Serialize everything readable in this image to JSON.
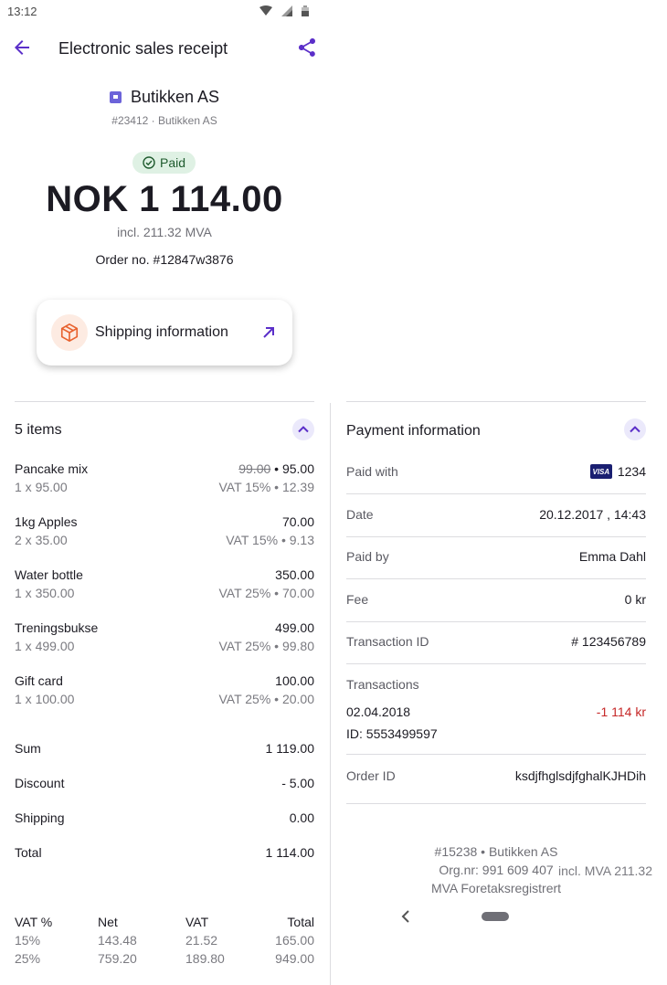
{
  "status_bar": {
    "time": "13:12"
  },
  "header": {
    "title": "Electronic sales receipt"
  },
  "merchant": {
    "name": "Butikken AS",
    "sub": "#23412 · Butikken AS"
  },
  "receipt": {
    "status": "Paid",
    "amount": "NOK 1 114.00",
    "incl_mva": "incl. 211.32 MVA",
    "order_no": "Order no. #12847w3876"
  },
  "shipping": {
    "label": "Shipping information"
  },
  "items_section": {
    "title": "5 items",
    "items": [
      {
        "name": "Pancake mix",
        "qty": "1 x 95.00",
        "original": "99.00",
        "price": "• 95.00",
        "vat": "VAT 15% • 12.39"
      },
      {
        "name": "1kg Apples",
        "qty": "2 x 35.00",
        "price": "70.00",
        "vat": "VAT 15% • 9.13"
      },
      {
        "name": "Water bottle",
        "qty": "1 x 350.00",
        "price": "350.00",
        "vat": "VAT 25% • 70.00"
      },
      {
        "name": "Treningsbukse",
        "qty": "1 x 499.00",
        "price": "499.00",
        "vat": "VAT 25% • 99.80"
      },
      {
        "name": "Gift card",
        "qty": "1 x 100.00",
        "price": "100.00",
        "vat": "VAT 25% • 20.00"
      }
    ],
    "sum": {
      "label": "Sum",
      "value": "1 119.00"
    },
    "discount": {
      "label": "Discount",
      "value": "- 5.00"
    },
    "shipping": {
      "label": "Shipping",
      "value": "0.00"
    },
    "total": {
      "label": "Total",
      "value": "1 114.00",
      "sub": "incl. MVA 211.32"
    },
    "vat_table": {
      "headers": [
        "VAT %",
        "Net",
        "VAT",
        "Total"
      ],
      "rows": [
        [
          "15%",
          "143.48",
          "21.52",
          "165.00"
        ],
        [
          "25%",
          "759.20",
          "189.80",
          "949.00"
        ]
      ]
    }
  },
  "payment_section": {
    "title": "Payment information",
    "paid_with": {
      "label": "Paid with",
      "card_brand": "VISA",
      "value": "1234"
    },
    "date": {
      "label": "Date",
      "value": "20.12.2017 , 14:43"
    },
    "paid_by": {
      "label": "Paid by",
      "value": "Emma Dahl"
    },
    "fee": {
      "label": "Fee",
      "value": "0 kr"
    },
    "transaction_id": {
      "label": "Transaction ID",
      "value": "# 123456789"
    },
    "transactions": {
      "label": "Transactions",
      "date": "02.04.2018",
      "amount": "-1 114 kr",
      "id": "ID: 5553499597"
    },
    "order_id": {
      "label": "Order ID",
      "value": "ksdjfhglsdjfghalKJHDih"
    }
  },
  "footer": {
    "line1": "#15238 • Butikken AS",
    "line2": "Org.nr: 991 609 407",
    "line3": "MVA Foretaksregistrert"
  },
  "colors": {
    "accent": "#5b2fc9",
    "paid_bg": "#dff1e4",
    "paid_text": "#1f5b2e",
    "negative": "#c62828",
    "shipping_icon": "#e8622f"
  }
}
